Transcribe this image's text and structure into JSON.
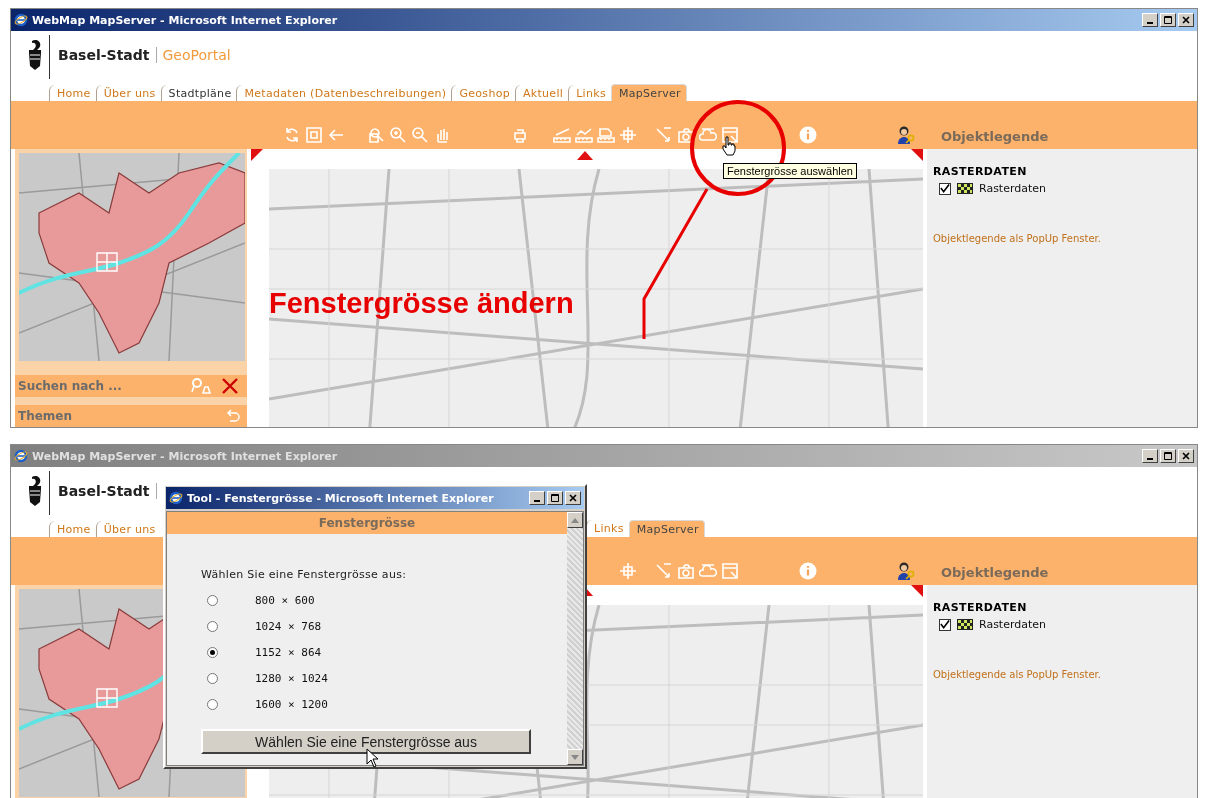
{
  "windows": [
    {
      "title": "WebMap MapServer - Microsoft Internet Explorer",
      "active": true,
      "logo": {
        "name": "Basel-Stadt",
        "portal": "GeoPortal"
      },
      "tabs": [
        {
          "label": "Home",
          "selected": false,
          "visited": false
        },
        {
          "label": "Über uns",
          "selected": false,
          "visited": false
        },
        {
          "label": "Stadtpläne",
          "selected": false,
          "visited": true
        },
        {
          "label": "Metadaten (Datenbeschreibungen)",
          "selected": false,
          "visited": false
        },
        {
          "label": "Geoshop",
          "selected": false,
          "visited": false
        },
        {
          "label": "Aktuell",
          "selected": false,
          "visited": false
        },
        {
          "label": "Links",
          "selected": false,
          "visited": false
        },
        {
          "label": "MapServer",
          "selected": true,
          "visited": false
        }
      ],
      "sidebar": {
        "search_label": "Suchen nach ...",
        "themes_label": "Themen"
      },
      "legend": {
        "title": "Objektlegende",
        "group": "RASTERDATEN",
        "layers": [
          {
            "label": "Rasterdaten",
            "checked": true
          }
        ],
        "popup_link": "Objektlegende als PopUp Fenster."
      },
      "annotation": "Fenstergrösse ändern",
      "tooltip": "Fenstergrösse auswählen"
    },
    {
      "title": "WebMap MapServer - Microsoft Internet Explorer",
      "active": false,
      "logo": {
        "name": "Basel-Stadt"
      },
      "tabs_left": [
        {
          "label": "Home",
          "selected": false,
          "visited": false
        },
        {
          "label": "Über uns",
          "selected": false,
          "visited": false
        }
      ],
      "tabs_right": [
        {
          "label": "Links",
          "selected": false,
          "visited": false
        },
        {
          "label": "MapServer",
          "selected": true,
          "visited": false
        }
      ],
      "legend": {
        "title": "Objektlegende",
        "group": "RASTERDATEN",
        "layers": [
          {
            "label": "Rasterdaten",
            "checked": true
          }
        ],
        "popup_link": "Objektlegende als PopUp Fenster."
      },
      "dialog": {
        "title": "Tool - Fenstergrösse - Microsoft Internet Explorer",
        "heading": "Fenstergrösse",
        "prompt": "Wählen Sie eine Fenstergrösse aus:",
        "options": [
          {
            "label": "800 × 600",
            "selected": false
          },
          {
            "label": "1024 × 768",
            "selected": false
          },
          {
            "label": "1152 × 864",
            "selected": true
          },
          {
            "label": "1280 × 1024",
            "selected": false
          },
          {
            "label": "1600 × 1200",
            "selected": false
          }
        ],
        "button": "Wählen Sie eine Fenstergrösse aus"
      }
    }
  ]
}
